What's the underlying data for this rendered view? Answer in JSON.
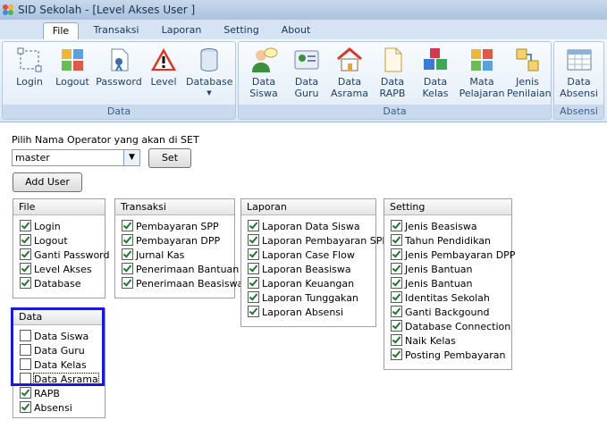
{
  "window": {
    "title": "SID Sekolah - [Level Akses User ]"
  },
  "menu_tabs": [
    {
      "label": "File",
      "active": true
    },
    {
      "label": "Transaksi",
      "active": false
    },
    {
      "label": "Laporan",
      "active": false
    },
    {
      "label": "Setting",
      "active": false
    },
    {
      "label": "About",
      "active": false
    }
  ],
  "ribbon": {
    "groups": [
      {
        "label": "Data",
        "buttons": [
          "Login",
          "Logout",
          "Password",
          "Level",
          "Database"
        ]
      },
      {
        "label": "Data",
        "buttons": [
          "Data Siswa",
          "Data Guru",
          "Data Asrama",
          "Data RAPB",
          "Data Kelas",
          "Mata Pelajaran",
          "Jenis Penilaian"
        ]
      },
      {
        "label": "Absensi",
        "buttons": [
          "Data Absensi"
        ]
      }
    ]
  },
  "operator": {
    "prompt": "Pilih Nama Operator yang akan di SET",
    "selected": "master",
    "set_label": "Set",
    "add_user_label": "Add User"
  },
  "panels": {
    "file": {
      "title": "File",
      "items": [
        {
          "label": "Login",
          "checked": true
        },
        {
          "label": "Logout",
          "checked": true
        },
        {
          "label": "Ganti Password",
          "checked": true
        },
        {
          "label": "Level Akses",
          "checked": true
        },
        {
          "label": "Database",
          "checked": true
        }
      ]
    },
    "transaksi": {
      "title": "Transaksi",
      "items": [
        {
          "label": "Pembayaran SPP",
          "checked": true
        },
        {
          "label": "Pembayaran DPP",
          "checked": true
        },
        {
          "label": "Jurnal Kas",
          "checked": true
        },
        {
          "label": "Penerimaan Bantuan",
          "checked": true
        },
        {
          "label": "Penerimaan Beasiswa",
          "checked": true
        }
      ]
    },
    "laporan": {
      "title": "Laporan",
      "items": [
        {
          "label": "Laporan Data Siswa",
          "checked": true
        },
        {
          "label": "Laporan Pembayaran SPP",
          "checked": true
        },
        {
          "label": "Laporan Case Flow",
          "checked": true
        },
        {
          "label": "Laporan Beasiswa",
          "checked": true
        },
        {
          "label": "Laporan Keuangan",
          "checked": true
        },
        {
          "label": "Laporan Tunggakan",
          "checked": true
        },
        {
          "label": "Laporan Absensi",
          "checked": true
        }
      ]
    },
    "setting": {
      "title": "Setting",
      "items": [
        {
          "label": "Jenis Beasiswa",
          "checked": true
        },
        {
          "label": "Tahun Pendidikan",
          "checked": true
        },
        {
          "label": "Jenis Pembayaran DPP",
          "checked": true
        },
        {
          "label": "Jenis Bantuan",
          "checked": true
        },
        {
          "label": "Jenis Bantuan",
          "checked": true
        },
        {
          "label": "Identitas Sekolah",
          "checked": true
        },
        {
          "label": "Ganti Backgound",
          "checked": true
        },
        {
          "label": "Database Connection",
          "checked": true
        },
        {
          "label": "Naik Kelas",
          "checked": true
        },
        {
          "label": "Posting Pembayaran",
          "checked": true
        }
      ]
    },
    "data": {
      "title": "Data",
      "items": [
        {
          "label": "Data Siswa",
          "checked": false
        },
        {
          "label": "Data Guru",
          "checked": false
        },
        {
          "label": "Data Kelas",
          "checked": false
        },
        {
          "label": "Data Asrama",
          "checked": false,
          "focused": true
        },
        {
          "label": "RAPB",
          "checked": true
        },
        {
          "label": "Absensi",
          "checked": true
        }
      ]
    }
  },
  "colors": {
    "highlight": "#1a1ad6",
    "check": "#1b7a2b",
    "ribbon_text": "#1d3f6c"
  }
}
